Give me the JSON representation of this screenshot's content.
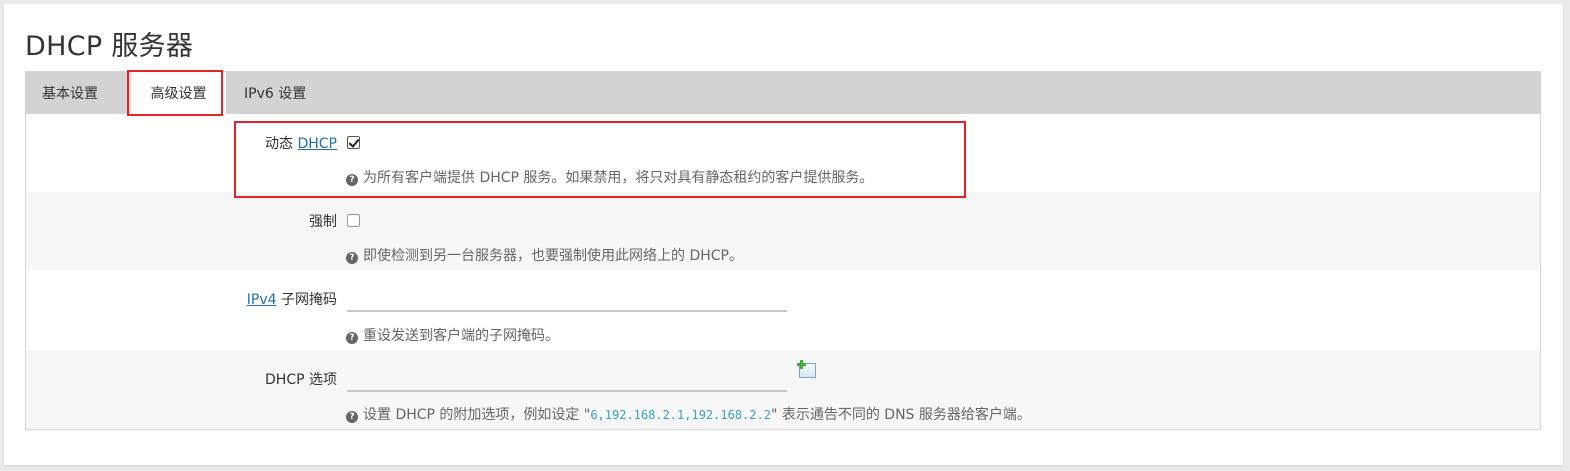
{
  "page": {
    "title": "DHCP 服务器"
  },
  "tabs": [
    {
      "label": "基本设置",
      "active": false
    },
    {
      "label": "高级设置",
      "active": true
    },
    {
      "label": "IPv6 设置",
      "active": false
    }
  ],
  "fields": {
    "dynamic_dhcp": {
      "label_prefix": "动态",
      "label_link": "DHCP",
      "checked": true,
      "help": "为所有客户端提供 DHCP 服务。如果禁用，将只对具有静态租约的客户提供服务。"
    },
    "force": {
      "label": "强制",
      "checked": false,
      "help": "即使检测到另一台服务器，也要强制使用此网络上的 DHCP。"
    },
    "netmask": {
      "label_link": "IPv4",
      "label_suffix": "子网掩码",
      "value": "",
      "help": "重设发送到客户端的子网掩码。"
    },
    "dhcp_options": {
      "label": "DHCP 选项",
      "value": "",
      "help_before": "设置 DHCP 的附加选项，例如设定 \"",
      "help_code": "6,192.168.2.1,192.168.2.2",
      "help_after": "\" 表示通告不同的 DNS 服务器给客户端。"
    }
  },
  "colors": {
    "highlight": "#e0262a",
    "link": "#1f6fb2",
    "tabbar": "#d3d3d3"
  }
}
